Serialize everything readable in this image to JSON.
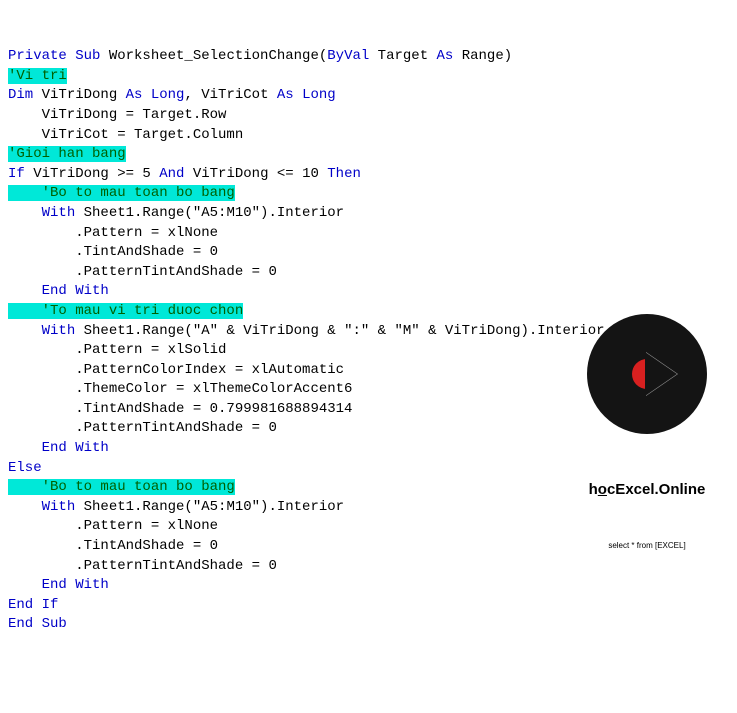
{
  "code": {
    "l1a": "Private Sub",
    "l1b": " Worksheet_SelectionChange(",
    "l1c": "ByVal",
    "l1d": " Target ",
    "l1e": "As",
    "l1f": " Range)",
    "l2": "'Vi tri",
    "l3a": "Dim",
    "l3b": " ViTriDong ",
    "l3c": "As Long",
    "l3d": ", ViTriCot ",
    "l3e": "As Long",
    "l4": "    ViTriDong = Target.Row",
    "l5": "    ViTriCot = Target.Column",
    "l6": "'Gioi han bang",
    "l7a": "If",
    "l7b": " ViTriDong >= 5 ",
    "l7c": "And",
    "l7d": " ViTriDong <= 10 ",
    "l7e": "Then",
    "l8": "    'Bo to mau toan bo bang",
    "l9a": "    ",
    "l9b": "With",
    "l9c": " Sheet1.Range(\"A5:M10\").Interior",
    "l10": "        .Pattern = xlNone",
    "l11": "        .TintAndShade = 0",
    "l12": "        .PatternTintAndShade = 0",
    "l13a": "    ",
    "l13b": "End With",
    "l14": "    'To mau vi tri duoc chon",
    "l15a": "    ",
    "l15b": "With",
    "l15c": " Sheet1.Range(\"A\" & ViTriDong & \":\" & \"M\" & ViTriDong).Interior",
    "l16": "        .Pattern = xlSolid",
    "l17": "        .PatternColorIndex = xlAutomatic",
    "l18": "        .ThemeColor = xlThemeColorAccent6",
    "l19": "        .TintAndShade = 0.799981688894314",
    "l20": "        .PatternTintAndShade = 0",
    "l21a": "    ",
    "l21b": "End With",
    "l22": "Else",
    "l23": "    'Bo to mau toan bo bang",
    "l24a": "    ",
    "l24b": "With",
    "l24c": " Sheet1.Range(\"A5:M10\").Interior",
    "l25": "        .Pattern = xlNone",
    "l26": "        .TintAndShade = 0",
    "l27": "        .PatternTintAndShade = 0",
    "l28a": "    ",
    "l28b": "End With",
    "l29": "End If",
    "l30": "End Sub"
  },
  "logo": {
    "text_pre": "h",
    "text_u": "o",
    "text_post": "cExcel.Online",
    "sub": "select * from [EXCEL]"
  }
}
